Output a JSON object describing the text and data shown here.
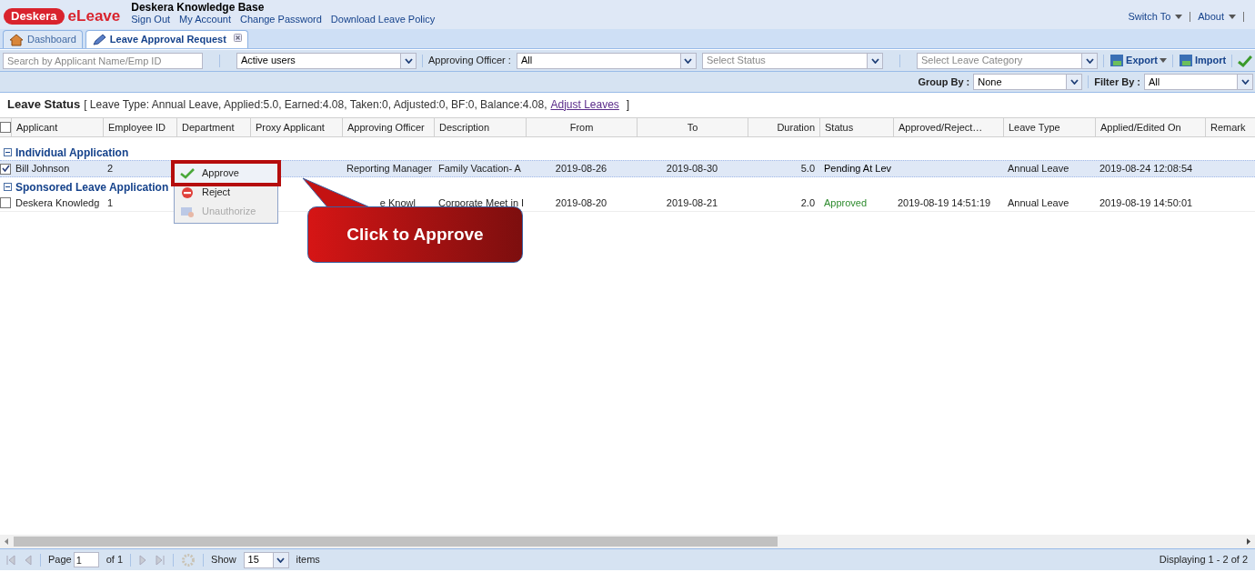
{
  "header": {
    "logo_badge": "Deskera",
    "logo_text": "eLeave",
    "company": "Deskera Knowledge Base",
    "links": [
      "Sign Out",
      "My Account",
      "Change Password",
      "Download Leave Policy"
    ],
    "right_menus": [
      "Switch To",
      "About"
    ]
  },
  "tabs": [
    {
      "label": "Dashboard",
      "selected": false,
      "closable": false
    },
    {
      "label": "Leave Approval Request",
      "selected": true,
      "closable": true
    }
  ],
  "toolbar": {
    "search": {
      "placeholder": "Search by Applicant Name/Emp ID"
    },
    "users": {
      "value": "Active users"
    },
    "approving_officer": {
      "label": "Approving Officer :",
      "value": "All"
    },
    "status": {
      "placeholder": "Select Status"
    },
    "category": {
      "placeholder": "Select Leave Category"
    },
    "export": "Export",
    "import": "Import"
  },
  "toolbar2": {
    "group_by": {
      "label": "Group By :",
      "value": "None"
    },
    "filter_by": {
      "label": "Filter By :",
      "value": "All"
    }
  },
  "leave_status": {
    "title": "Leave Status",
    "details": "[ Leave Type: Annual Leave, Applied:5.0, Earned:4.08, Taken:0, Adjusted:0, BF:0, Balance:4.08,",
    "link": "Adjust Leaves",
    "close": "]"
  },
  "table": {
    "all_checked": false,
    "columns": [
      "Applicant",
      "Employee ID",
      "Department",
      "Proxy Applicant",
      "Approving Officer",
      "Description",
      "From",
      "To",
      "Duration",
      "Status",
      "Approved/Reject…",
      "Leave Type",
      "Applied/Edited On",
      "Remark"
    ],
    "groups": [
      {
        "title": "Individual Application",
        "expanded": true,
        "rows": [
          {
            "selected": true,
            "cells": [
              "Bill Johnson",
              "2",
              "",
              "",
              "Reporting Manager",
              "Family Vacation- A",
              "2019-08-26",
              "2019-08-30",
              "5.0",
              "Pending At Lev",
              "",
              "Annual Leave",
              "2019-08-24 12:08:54",
              ""
            ],
            "color": "#000000"
          }
        ]
      },
      {
        "title": "Sponsored Leave Application",
        "expanded": true,
        "rows": [
          {
            "selected": false,
            "cells": [
              "Deskera Knowledg",
              "1",
              "",
              "",
              "e Knowl",
              "Corporate Meet in I",
              "2019-08-20",
              "2019-08-21",
              "2.0",
              "Approved",
              "2019-08-19 14:51:19",
              "Annual Leave",
              "2019-08-19 14:50:01",
              ""
            ],
            "color": "#2e8b2e"
          }
        ]
      }
    ]
  },
  "context_menu": [
    {
      "label": "Approve",
      "kind": "approve",
      "disabled": false,
      "highlighted": true
    },
    {
      "label": "Reject",
      "kind": "reject",
      "disabled": false,
      "highlighted": false
    },
    {
      "label": "Unauthorize",
      "kind": "unauthorize",
      "disabled": true,
      "highlighted": false
    }
  ],
  "callout": "Click to Approve",
  "paging": {
    "page_label": "Page",
    "page": "1",
    "of": "of 1",
    "show": "Show",
    "size": "15",
    "items": "items",
    "displaying": "Displaying 1 - 2 of 2"
  }
}
